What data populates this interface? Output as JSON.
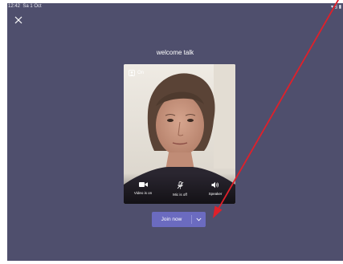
{
  "status_bar": {
    "time": "12:42",
    "date": "Sa 1 Oct",
    "indicators": "▾ § ▮"
  },
  "header": {
    "close_icon": "close-icon"
  },
  "meeting": {
    "title": "welcome talk"
  },
  "preview": {
    "background_toggle_label": "On",
    "background_icon": "person-background-icon"
  },
  "controls": [
    {
      "id": "video",
      "label": "Video is on",
      "icon": "video-camera-icon"
    },
    {
      "id": "mic",
      "label": "Mic is off",
      "icon": "mic-off-icon"
    },
    {
      "id": "speaker",
      "label": "Speaker",
      "icon": "speaker-icon"
    }
  ],
  "join": {
    "label": "Join now",
    "options_icon": "chevron-down-icon"
  },
  "colors": {
    "background": "#4f4f6d",
    "join_button": "#6b6bc0",
    "annotation_arrow": "#e0202a"
  }
}
